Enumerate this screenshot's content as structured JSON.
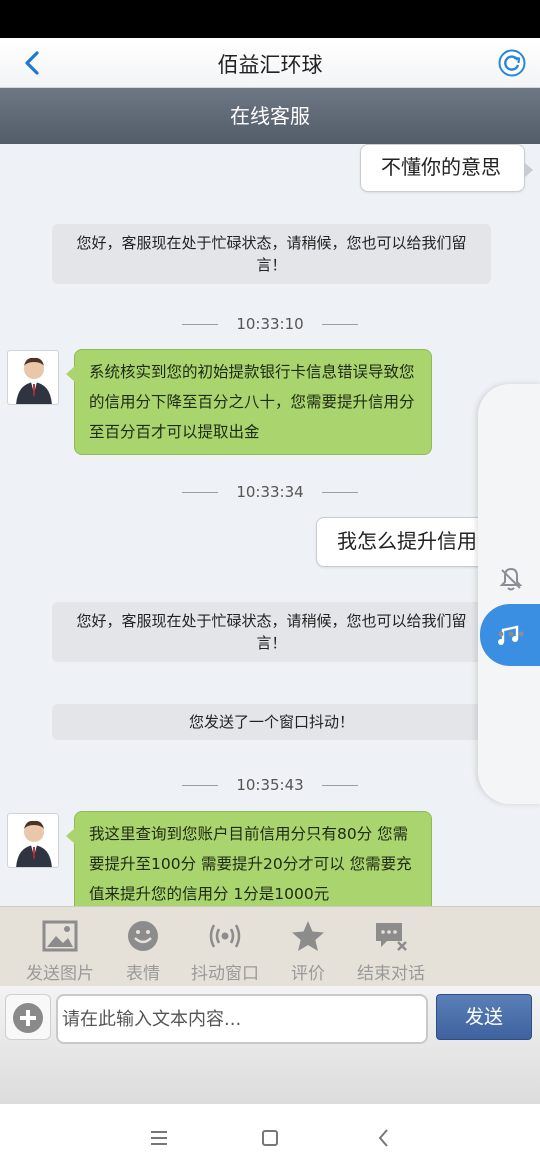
{
  "header": {
    "title": "佰益汇环球"
  },
  "subheader": {
    "title": "在线客服"
  },
  "messages": {
    "m1": "不懂你的意思",
    "m2": "您好，客服现在处于忙碌状态，请稍候，您也可以给我们留言！",
    "t1": "10:33:10",
    "m3": "系统核实到您的初始提款银行卡信息错误导致您的信用分下降至百分之八十，您需要提升信用分至百分百才可以提取出金",
    "t2": "10:33:34",
    "m4": "我怎么提升信用分",
    "m5": "您好，客服现在处于忙碌状态，请稍候，您也可以给我们留言！",
    "m6": "您发送了一个窗口抖动！",
    "t3": "10:35:43",
    "m7": "我这里查询到您账户目前信用分只有80分  您需要提升至100分 需要提升20分才可以  您需要充值来提升您的信用分 1分是1000元"
  },
  "toolbar": {
    "send_image": "发送图片",
    "emoji": "表情",
    "shake": "抖动窗口",
    "rate": "评价",
    "end_chat": "结束对话"
  },
  "input": {
    "placeholder": "请在此输入文本内容...",
    "send_label": "发送"
  },
  "colors": {
    "accent": "#3b8fe3",
    "agent_bubble": "#a9d46e",
    "header_bar": "#5b6470"
  }
}
